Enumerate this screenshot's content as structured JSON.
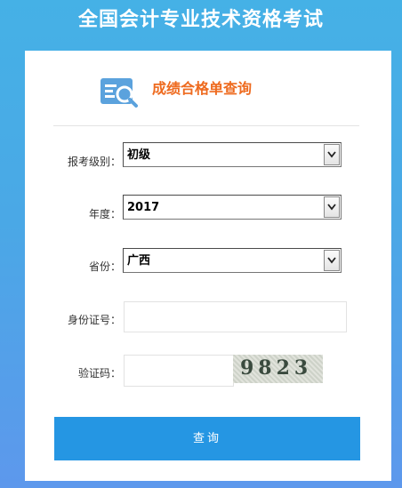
{
  "page": {
    "title": "全国会计专业技术资格考试"
  },
  "card": {
    "title": "成绩合格单查询",
    "icon": "search-document-icon",
    "accent_color": "#ee6a1e"
  },
  "form": {
    "level": {
      "label": "报考级别：",
      "value": "初级"
    },
    "year": {
      "label": "年度：",
      "value": "2017"
    },
    "province": {
      "label": "省份：",
      "value": "广西"
    },
    "id_number": {
      "label": "身份证号：",
      "value": ""
    },
    "captcha": {
      "label": "验证码：",
      "value": "",
      "image_text": "9823"
    },
    "submit_label": "查询",
    "button_color": "#2596e3"
  }
}
